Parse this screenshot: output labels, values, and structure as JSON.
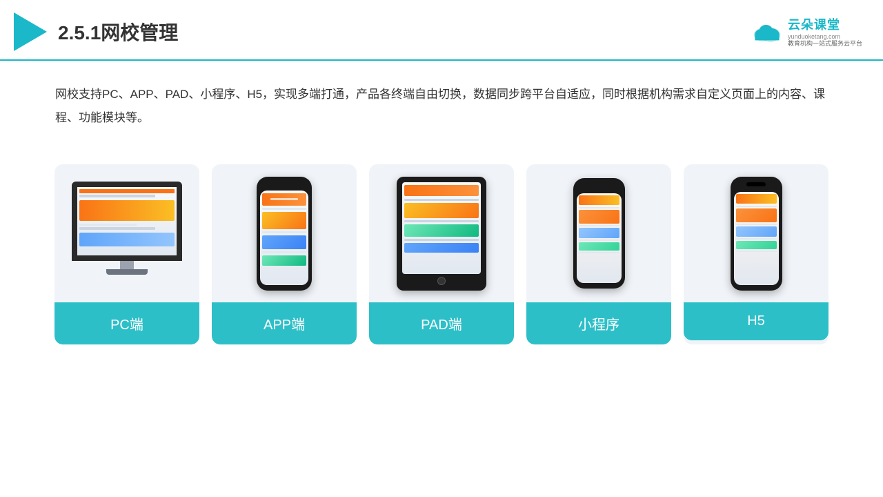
{
  "header": {
    "title": "2.5.1网校管理",
    "brand": {
      "name": "云朵课堂",
      "url": "yunduoketang.com",
      "slogan": "教育机构一站\n式服务云平台"
    }
  },
  "description": "网校支持PC、APP、PAD、小程序、H5，实现多端打通，产品各终端自由切换，数据同步跨平台自适应，同时根据机构需求自定义页面上的内容、课程、功能模块等。",
  "cards": [
    {
      "id": "pc",
      "label": "PC端"
    },
    {
      "id": "app",
      "label": "APP端"
    },
    {
      "id": "pad",
      "label": "PAD端"
    },
    {
      "id": "miniprogram",
      "label": "小程序"
    },
    {
      "id": "h5",
      "label": "H5"
    }
  ],
  "colors": {
    "teal": "#2dbfc8",
    "accent": "#1ab8c8"
  }
}
